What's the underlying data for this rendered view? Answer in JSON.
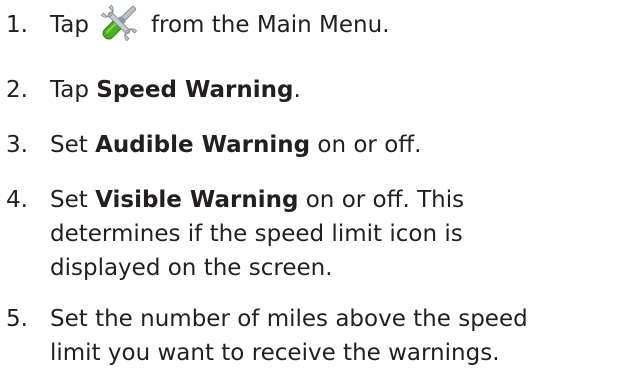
{
  "steps": [
    {
      "number": "1.",
      "before_icon": "Tap",
      "icon": "tools-icon",
      "after_icon": "from the Main Menu."
    },
    {
      "number": "2.",
      "prefix": "Tap ",
      "bold": "Speed Warning",
      "suffix": "."
    },
    {
      "number": "3.",
      "prefix": "Set ",
      "bold": "Audible Warning",
      "suffix": " on or off."
    },
    {
      "number": "4.",
      "prefix": "Set ",
      "bold": "Visible Warning",
      "suffix": " on or off. This",
      "continuation": [
        "determines if the speed limit icon is",
        "displayed on the screen."
      ]
    },
    {
      "number": "5.",
      "lines": [
        "Set the number of miles above the speed",
        "limit you want to receive the warnings."
      ]
    }
  ],
  "colors": {
    "text": "#231f20",
    "icon_green": "#4caf1e",
    "icon_silver": "#b9c0c6"
  }
}
